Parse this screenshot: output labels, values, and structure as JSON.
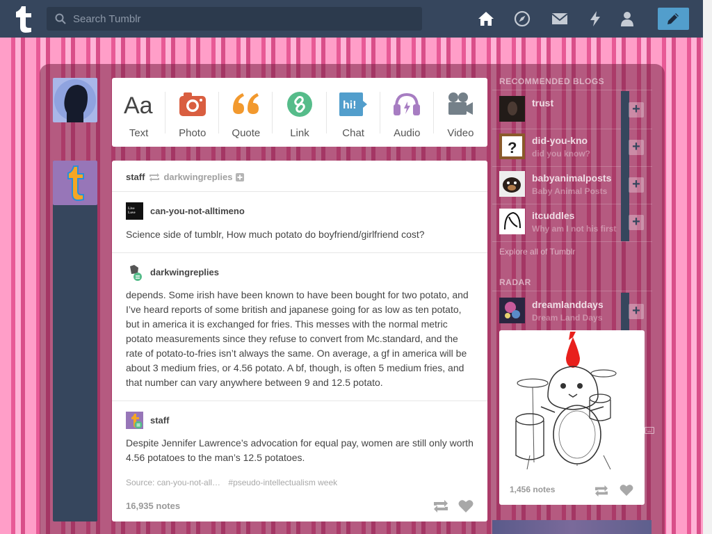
{
  "search": {
    "placeholder": "Search Tumblr"
  },
  "nav": [
    "home-icon",
    "explore-icon",
    "messages-icon",
    "activity-icon",
    "account-icon",
    "compose-icon"
  ],
  "post_types": [
    {
      "label": "Text",
      "icon": "text-icon",
      "color": "#444444"
    },
    {
      "label": "Photo",
      "icon": "camera-icon",
      "color": "#d95e40"
    },
    {
      "label": "Quote",
      "icon": "quote-icon",
      "color": "#f2992e"
    },
    {
      "label": "Link",
      "icon": "link-icon",
      "color": "#56bc8a"
    },
    {
      "label": "Chat",
      "icon": "chat-icon",
      "color": "#529ecc"
    },
    {
      "label": "Audio",
      "icon": "headphones-icon",
      "color": "#a77dc2"
    },
    {
      "label": "Video",
      "icon": "video-camera-icon",
      "color": "#748089"
    }
  ],
  "post": {
    "author": "staff",
    "reblogged_from": "darkwingreplies",
    "entries": [
      {
        "user": "can-you-not-alltimeno",
        "text": "Science side of tumblr, How much potato do boyfriend/girlfriend cost?"
      },
      {
        "user": "darkwingreplies",
        "text": "depends. Some irish have been known to have been bought for two potato, and I’ve heard reports of some british and japanese going for as low as ten potato, but in america it is exchanged for fries. This messes with the normal metric potato measurements since they refuse to convert from Mc.standard, and the rate of potato-to-fries isn’t always the same. On average, a gf in america will be about 3 medium fries, or 4.56 potato. A bf, though, is often 5 medium fries, and that number can vary anywhere between 9 and 12.5 potato."
      },
      {
        "user": "staff",
        "text": "Despite Jennifer Lawrence’s advocation for equal pay, women are still only worth 4.56 potatoes to the man’s 12.5 potatoes."
      }
    ],
    "source": "Source: can-you-not-all…",
    "tag": "#pseudo-intellectualism week",
    "notes": "16,935 notes"
  },
  "recommended": {
    "title": "RECOMMENDED BLOGS",
    "blogs": [
      {
        "name": "trust",
        "subtitle": ""
      },
      {
        "name": "did-you-kno",
        "subtitle": "did you know?"
      },
      {
        "name": "babyanimalposts",
        "subtitle": "Baby Animal Posts"
      },
      {
        "name": "itcuddles",
        "subtitle": "Why am I not his first"
      }
    ],
    "explore": "Explore all of Tumblr"
  },
  "radar": {
    "title": "RADAR",
    "blog": {
      "name": "dreamlanddays",
      "subtitle": "Dream Land Days"
    },
    "notes": "1,456 notes"
  },
  "colors": {
    "topbar": "#36465d",
    "accent": "#529ecc"
  }
}
